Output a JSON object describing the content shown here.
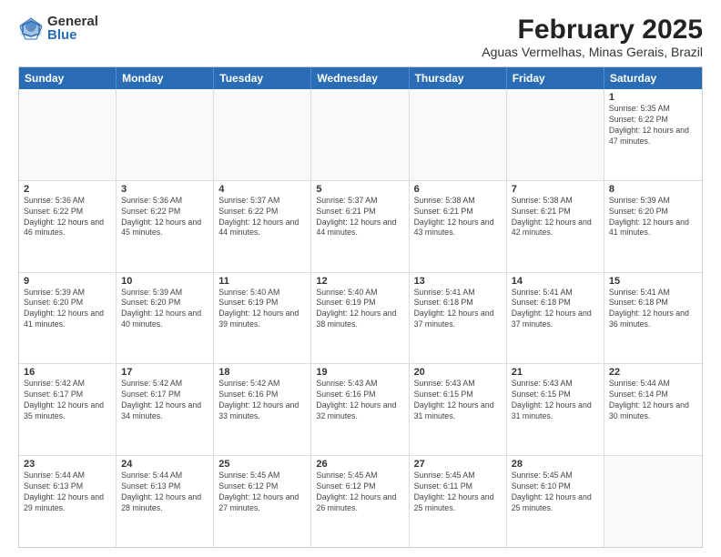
{
  "logo": {
    "general": "General",
    "blue": "Blue"
  },
  "title": "February 2025",
  "subtitle": "Aguas Vermelhas, Minas Gerais, Brazil",
  "header": {
    "days": [
      "Sunday",
      "Monday",
      "Tuesday",
      "Wednesday",
      "Thursday",
      "Friday",
      "Saturday"
    ]
  },
  "weeks": [
    [
      {
        "day": "",
        "info": ""
      },
      {
        "day": "",
        "info": ""
      },
      {
        "day": "",
        "info": ""
      },
      {
        "day": "",
        "info": ""
      },
      {
        "day": "",
        "info": ""
      },
      {
        "day": "",
        "info": ""
      },
      {
        "day": "1",
        "info": "Sunrise: 5:35 AM\nSunset: 6:22 PM\nDaylight: 12 hours\nand 47 minutes."
      }
    ],
    [
      {
        "day": "2",
        "info": "Sunrise: 5:36 AM\nSunset: 6:22 PM\nDaylight: 12 hours\nand 46 minutes."
      },
      {
        "day": "3",
        "info": "Sunrise: 5:36 AM\nSunset: 6:22 PM\nDaylight: 12 hours\nand 45 minutes."
      },
      {
        "day": "4",
        "info": "Sunrise: 5:37 AM\nSunset: 6:22 PM\nDaylight: 12 hours\nand 44 minutes."
      },
      {
        "day": "5",
        "info": "Sunrise: 5:37 AM\nSunset: 6:21 PM\nDaylight: 12 hours\nand 44 minutes."
      },
      {
        "day": "6",
        "info": "Sunrise: 5:38 AM\nSunset: 6:21 PM\nDaylight: 12 hours\nand 43 minutes."
      },
      {
        "day": "7",
        "info": "Sunrise: 5:38 AM\nSunset: 6:21 PM\nDaylight: 12 hours\nand 42 minutes."
      },
      {
        "day": "8",
        "info": "Sunrise: 5:39 AM\nSunset: 6:20 PM\nDaylight: 12 hours\nand 41 minutes."
      }
    ],
    [
      {
        "day": "9",
        "info": "Sunrise: 5:39 AM\nSunset: 6:20 PM\nDaylight: 12 hours\nand 41 minutes."
      },
      {
        "day": "10",
        "info": "Sunrise: 5:39 AM\nSunset: 6:20 PM\nDaylight: 12 hours\nand 40 minutes."
      },
      {
        "day": "11",
        "info": "Sunrise: 5:40 AM\nSunset: 6:19 PM\nDaylight: 12 hours\nand 39 minutes."
      },
      {
        "day": "12",
        "info": "Sunrise: 5:40 AM\nSunset: 6:19 PM\nDaylight: 12 hours\nand 38 minutes."
      },
      {
        "day": "13",
        "info": "Sunrise: 5:41 AM\nSunset: 6:18 PM\nDaylight: 12 hours\nand 37 minutes."
      },
      {
        "day": "14",
        "info": "Sunrise: 5:41 AM\nSunset: 6:18 PM\nDaylight: 12 hours\nand 37 minutes."
      },
      {
        "day": "15",
        "info": "Sunrise: 5:41 AM\nSunset: 6:18 PM\nDaylight: 12 hours\nand 36 minutes."
      }
    ],
    [
      {
        "day": "16",
        "info": "Sunrise: 5:42 AM\nSunset: 6:17 PM\nDaylight: 12 hours\nand 35 minutes."
      },
      {
        "day": "17",
        "info": "Sunrise: 5:42 AM\nSunset: 6:17 PM\nDaylight: 12 hours\nand 34 minutes."
      },
      {
        "day": "18",
        "info": "Sunrise: 5:42 AM\nSunset: 6:16 PM\nDaylight: 12 hours\nand 33 minutes."
      },
      {
        "day": "19",
        "info": "Sunrise: 5:43 AM\nSunset: 6:16 PM\nDaylight: 12 hours\nand 32 minutes."
      },
      {
        "day": "20",
        "info": "Sunrise: 5:43 AM\nSunset: 6:15 PM\nDaylight: 12 hours\nand 31 minutes."
      },
      {
        "day": "21",
        "info": "Sunrise: 5:43 AM\nSunset: 6:15 PM\nDaylight: 12 hours\nand 31 minutes."
      },
      {
        "day": "22",
        "info": "Sunrise: 5:44 AM\nSunset: 6:14 PM\nDaylight: 12 hours\nand 30 minutes."
      }
    ],
    [
      {
        "day": "23",
        "info": "Sunrise: 5:44 AM\nSunset: 6:13 PM\nDaylight: 12 hours\nand 29 minutes."
      },
      {
        "day": "24",
        "info": "Sunrise: 5:44 AM\nSunset: 6:13 PM\nDaylight: 12 hours\nand 28 minutes."
      },
      {
        "day": "25",
        "info": "Sunrise: 5:45 AM\nSunset: 6:12 PM\nDaylight: 12 hours\nand 27 minutes."
      },
      {
        "day": "26",
        "info": "Sunrise: 5:45 AM\nSunset: 6:12 PM\nDaylight: 12 hours\nand 26 minutes."
      },
      {
        "day": "27",
        "info": "Sunrise: 5:45 AM\nSunset: 6:11 PM\nDaylight: 12 hours\nand 25 minutes."
      },
      {
        "day": "28",
        "info": "Sunrise: 5:45 AM\nSunset: 6:10 PM\nDaylight: 12 hours\nand 25 minutes."
      },
      {
        "day": "",
        "info": ""
      }
    ]
  ]
}
